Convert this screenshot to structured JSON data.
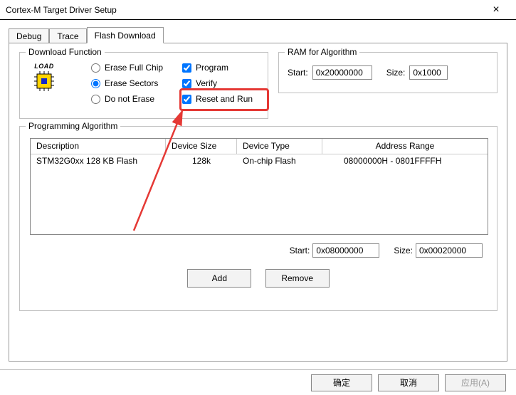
{
  "window": {
    "title": "Cortex-M Target Driver Setup"
  },
  "tabs": {
    "debug": "Debug",
    "trace": "Trace",
    "flash": "Flash Download",
    "active": "flash"
  },
  "download": {
    "legend": "Download Function",
    "loadText": "LOAD",
    "radios": {
      "erase_full": "Erase Full Chip",
      "erase_sectors": "Erase Sectors",
      "do_not_erase": "Do not Erase",
      "selected": "erase_sectors"
    },
    "checks": {
      "program": "Program",
      "verify": "Verify",
      "reset_run": "Reset and Run",
      "program_v": true,
      "verify_v": true,
      "reset_run_v": true
    }
  },
  "ram": {
    "legend": "RAM for Algorithm",
    "start_label": "Start:",
    "start_value": "0x20000000",
    "size_label": "Size:",
    "size_value": "0x1000"
  },
  "prog": {
    "legend": "Programming Algorithm",
    "columns": {
      "desc": "Description",
      "dsize": "Device Size",
      "dtype": "Device Type",
      "addr": "Address Range"
    },
    "rows": [
      {
        "desc": "STM32G0xx 128 KB Flash",
        "dsize": "128k",
        "dtype": "On-chip Flash",
        "addr": "08000000H - 0801FFFFH"
      }
    ],
    "start_label": "Start:",
    "start_value": "0x08000000",
    "size_label": "Size:",
    "size_value": "0x00020000",
    "add": "Add",
    "remove": "Remove"
  },
  "footer": {
    "ok": "确定",
    "cancel": "取消",
    "apply": "应用(A)"
  }
}
